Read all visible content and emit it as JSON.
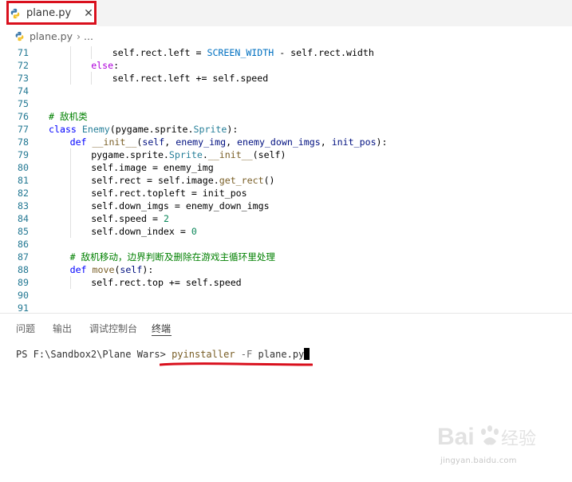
{
  "tab": {
    "label": "plane.py",
    "close_glyph": "✕",
    "icon": "python-icon"
  },
  "breadcrumb": {
    "file": "plane.py",
    "separator": "›",
    "ellipsis": "..."
  },
  "editor": {
    "lines": [
      {
        "n": "71",
        "indent": 3,
        "tokens": [
          [
            "self.rect.left = ",
            ""
          ],
          [
            "SCREEN_WIDTH",
            "cst"
          ],
          [
            " - self.rect.width",
            ""
          ]
        ]
      },
      {
        "n": "72",
        "indent": 2,
        "tokens": [
          [
            "else",
            "kw2"
          ],
          [
            ":",
            ""
          ]
        ]
      },
      {
        "n": "73",
        "indent": 3,
        "tokens": [
          [
            "self.rect.left += self.speed",
            ""
          ]
        ]
      },
      {
        "n": "74",
        "indent": 0,
        "tokens": []
      },
      {
        "n": "75",
        "indent": 0,
        "tokens": []
      },
      {
        "n": "76",
        "indent": 0,
        "tokens": [
          [
            "# 敌机类",
            "cmt"
          ]
        ]
      },
      {
        "n": "77",
        "indent": 0,
        "tokens": [
          [
            "class ",
            "kw"
          ],
          [
            "Enemy",
            "cls"
          ],
          [
            "(pygame.sprite.",
            ""
          ],
          [
            "Sprite",
            "cls"
          ],
          [
            "):",
            ""
          ]
        ]
      },
      {
        "n": "78",
        "indent": 1,
        "tokens": [
          [
            "def ",
            "kw"
          ],
          [
            "__init__",
            "fn"
          ],
          [
            "(",
            ""
          ],
          [
            "self",
            "par"
          ],
          [
            ", ",
            ""
          ],
          [
            "enemy_img",
            "par"
          ],
          [
            ", ",
            ""
          ],
          [
            "enemy_down_imgs",
            "par"
          ],
          [
            ", ",
            ""
          ],
          [
            "init_pos",
            "par"
          ],
          [
            "):",
            ""
          ]
        ]
      },
      {
        "n": "79",
        "indent": 2,
        "tokens": [
          [
            "pygame.sprite.",
            ""
          ],
          [
            "Sprite",
            "cls"
          ],
          [
            ".",
            ""
          ],
          [
            "__init__",
            "fn"
          ],
          [
            "(self)",
            ""
          ]
        ]
      },
      {
        "n": "80",
        "indent": 2,
        "tokens": [
          [
            "self.image = enemy_img",
            ""
          ]
        ]
      },
      {
        "n": "81",
        "indent": 2,
        "tokens": [
          [
            "self.rect = self.image.",
            ""
          ],
          [
            "get_rect",
            "fn"
          ],
          [
            "()",
            ""
          ]
        ]
      },
      {
        "n": "82",
        "indent": 2,
        "tokens": [
          [
            "self.rect.topleft = init_pos",
            ""
          ]
        ]
      },
      {
        "n": "83",
        "indent": 2,
        "tokens": [
          [
            "self.down_imgs = enemy_down_imgs",
            ""
          ]
        ]
      },
      {
        "n": "84",
        "indent": 2,
        "tokens": [
          [
            "self.speed = ",
            ""
          ],
          [
            "2",
            "num"
          ]
        ]
      },
      {
        "n": "85",
        "indent": 2,
        "tokens": [
          [
            "self.down_index = ",
            ""
          ],
          [
            "0",
            "num"
          ]
        ]
      },
      {
        "n": "86",
        "indent": 0,
        "tokens": []
      },
      {
        "n": "87",
        "indent": 1,
        "tokens": [
          [
            "# 敌机移动，边界判断及删除在游戏主循环里处理",
            "cmt"
          ]
        ]
      },
      {
        "n": "88",
        "indent": 1,
        "tokens": [
          [
            "def ",
            "kw"
          ],
          [
            "move",
            "fn"
          ],
          [
            "(",
            ""
          ],
          [
            "self",
            "par"
          ],
          [
            "):",
            ""
          ]
        ]
      },
      {
        "n": "89",
        "indent": 2,
        "tokens": [
          [
            "self.rect.top += self.speed",
            ""
          ]
        ]
      },
      {
        "n": "90",
        "indent": 0,
        "tokens": []
      },
      {
        "n": "91",
        "indent": 0,
        "tokens": []
      }
    ]
  },
  "panel": {
    "tabs": [
      {
        "label": "问题",
        "active": false
      },
      {
        "label": "输出",
        "active": false
      },
      {
        "label": "调试控制台",
        "active": false
      },
      {
        "label": "终端",
        "active": true
      }
    ]
  },
  "terminal": {
    "prompt": "PS F:\\Sandbox2\\Plane Wars> ",
    "command": "pyinstaller",
    "flag": " -F",
    "arg": " plane.py"
  },
  "watermark": {
    "logo": "Baidu经验",
    "url": "jingyan.baidu.com"
  },
  "colors": {
    "highlight": "#d9101d",
    "comment": "#008000",
    "keyword": "#0000ff",
    "control": "#af00db"
  }
}
